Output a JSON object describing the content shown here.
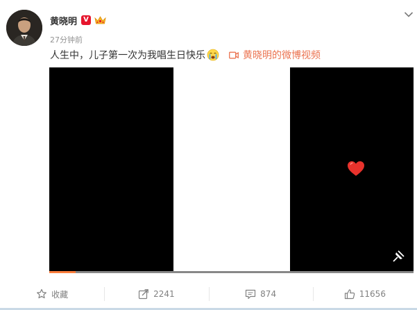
{
  "post": {
    "author": "黄晓明",
    "verified_badge": "V",
    "time": "27分钟前",
    "text": "人生中，儿子第一次为我唱生日快乐",
    "video_link": "黄晓明的微博视频"
  },
  "player": {
    "progress_fraction": 0.072
  },
  "actions": {
    "favorite": "收藏",
    "repost": "2241",
    "comment": "874",
    "like": "11656"
  },
  "colors": {
    "accent_orange": "#eb7350",
    "verified_red": "#e6162d",
    "progress": "#fa7d3c",
    "text_gray": "#808080"
  },
  "icons": [
    "chevron-down-icon",
    "crown-icon",
    "crying-emoji-icon",
    "video-icon",
    "heart-icon",
    "pip-icon",
    "star-icon",
    "share-icon",
    "comment-icon",
    "thumbs-up-icon"
  ]
}
